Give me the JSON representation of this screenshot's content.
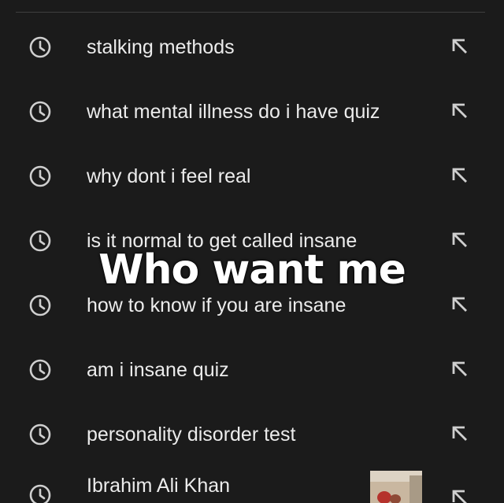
{
  "history": {
    "items": [
      {
        "label": "stalking methods",
        "icon": "history-clock-icon",
        "action_icon": "fill-query-arrow-icon"
      },
      {
        "label": "what mental illness do i have quiz",
        "icon": "history-clock-icon",
        "action_icon": "fill-query-arrow-icon"
      },
      {
        "label": "why dont i feel real",
        "icon": "history-clock-icon",
        "action_icon": "fill-query-arrow-icon"
      },
      {
        "label": "is it normal to get called insane",
        "icon": "history-clock-icon",
        "action_icon": "fill-query-arrow-icon"
      },
      {
        "label": "how to know if you are insane",
        "icon": "history-clock-icon",
        "action_icon": "fill-query-arrow-icon"
      },
      {
        "label": "am i insane quiz",
        "icon": "history-clock-icon",
        "action_icon": "fill-query-arrow-icon"
      },
      {
        "label": "personality disorder test",
        "icon": "history-clock-icon",
        "action_icon": "fill-query-arrow-icon"
      },
      {
        "label": "Ibrahim Ali Khan",
        "icon": "history-clock-icon",
        "action_icon": "fill-query-arrow-icon",
        "has_thumbnail": true
      }
    ]
  },
  "overlay": {
    "caption": "Who want me"
  },
  "colors": {
    "background": "#1b1b1b",
    "text": "#ececec",
    "icon": "#cfcfcf",
    "divider": "#3f3f3f"
  }
}
